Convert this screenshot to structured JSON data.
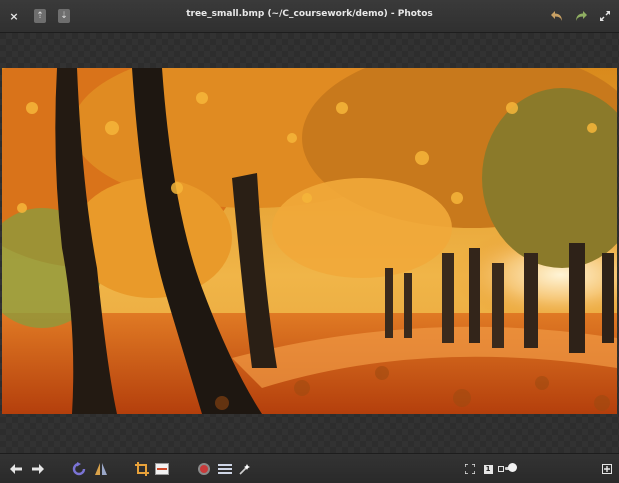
{
  "window": {
    "title": "tree_small.bmp (~/C_coursework/demo) - Photos",
    "close_glyph": "×"
  },
  "header": {
    "left_icons": [
      "close-icon",
      "export-icon",
      "save-icon"
    ],
    "right_icons": [
      "undo-icon",
      "redo-icon",
      "fullscreen-icon"
    ]
  },
  "image": {
    "description_icon": "photo-autumn-trees",
    "accent": "#e8771a"
  },
  "toolbar": {
    "icons": [
      "back-icon",
      "forward-icon",
      "rotate-icon",
      "flip-icon",
      "crop-icon",
      "straighten-icon",
      "red-eye-icon",
      "adjust-icon",
      "enhance-icon",
      "zoom-fit-icon",
      "zoom-100-icon",
      "zoom-slider",
      "zoom-in-icon"
    ],
    "zoom_100_label": "1",
    "zoom_level": 0.25
  }
}
